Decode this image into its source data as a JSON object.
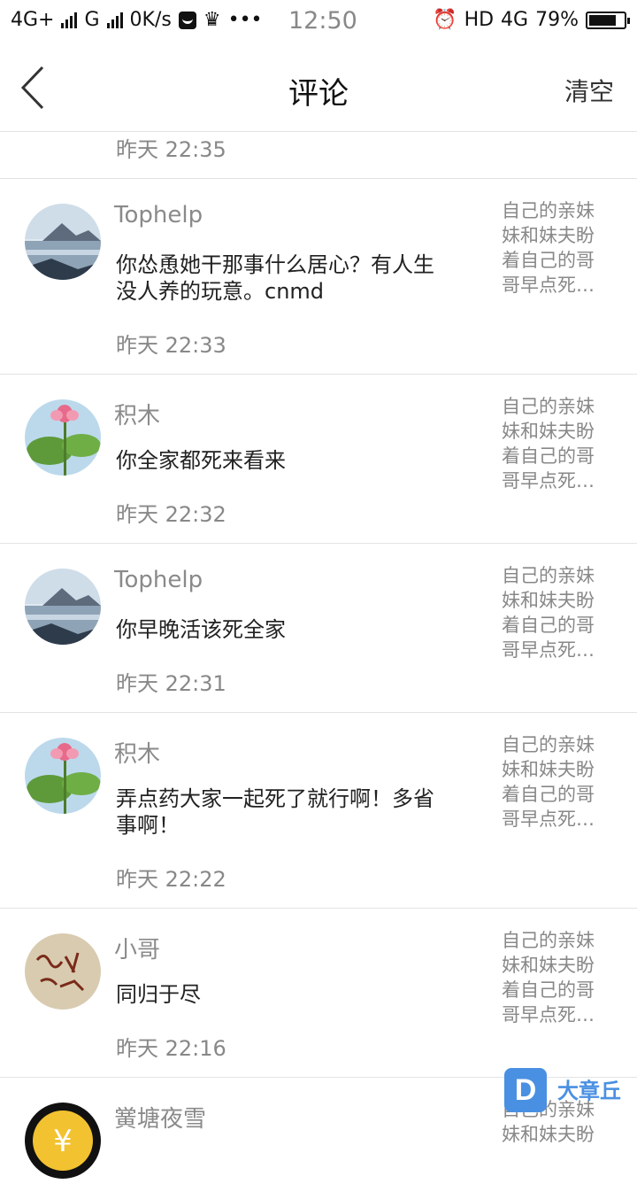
{
  "status_bar": {
    "network_1": "4G+",
    "network_2": "G",
    "speed": "0K/s",
    "time": "12:50",
    "hd": "HD",
    "network_3": "4G",
    "battery": "79%",
    "battery_level": 0.79
  },
  "header": {
    "title": "评论",
    "clear_label": "清空"
  },
  "partial_row": {
    "time": "昨天 22:35"
  },
  "comments": [
    {
      "name": "Tophelp",
      "text": "你怂恿她干那事什么居心？有人生没人养的玩意。cnmd",
      "time": "昨天 22:33",
      "quote": [
        "自己的亲妹",
        "妹和妹夫盼",
        "着自己的哥",
        "哥早点死…"
      ],
      "avatar": "landscape"
    },
    {
      "name": "积木",
      "text": "你全家都死来看来",
      "time": "昨天 22:32",
      "quote": [
        "自己的亲妹",
        "妹和妹夫盼",
        "着自己的哥",
        "哥早点死…"
      ],
      "avatar": "lotus"
    },
    {
      "name": "Tophelp",
      "text": "你早晚活该死全家",
      "time": "昨天 22:31",
      "quote": [
        "自己的亲妹",
        "妹和妹夫盼",
        "着自己的哥",
        "哥早点死…"
      ],
      "avatar": "landscape"
    },
    {
      "name": "积木",
      "text": "弄点药大家一起死了就行啊！多省事啊！",
      "time": "昨天 22:22",
      "quote": [
        "自己的亲妹",
        "妹和妹夫盼",
        "着自己的哥",
        "哥早点死…"
      ],
      "avatar": "lotus"
    },
    {
      "name": "小哥",
      "text": "同归于尽",
      "time": "昨天 22:16",
      "quote": [
        "自己的亲妹",
        "妹和妹夫盼",
        "着自己的哥",
        "哥早点死…"
      ],
      "avatar": "calligraphy"
    },
    {
      "name": "黉塘夜雪",
      "text": "",
      "time": "",
      "quote": [
        "自己的亲妹",
        "妹和妹夫盼"
      ],
      "avatar": "coin"
    }
  ],
  "watermark": {
    "icon_letter": "D",
    "text": "大章丘"
  },
  "colors": {
    "divider": "#e3e3e3",
    "accent": "#4a90e2"
  }
}
